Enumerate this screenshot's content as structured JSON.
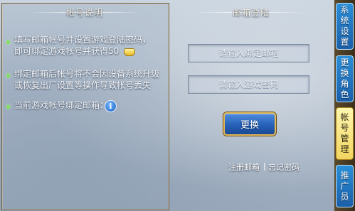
{
  "left_panel": {
    "title": "帐号说明",
    "item1_line1": "填写邮箱帐号并设置游戏登陆密码，",
    "item1_line2": "即可绑定游戏帐号并获得50",
    "item2_line1": "绑定邮箱后帐号将不会因设备系统升级",
    "item2_line2": "或恢复出厂设置等操作导致帐号丢失",
    "item3": "当前游戏帐号绑定邮箱：",
    "reward_icon": "gold-ingot-icon",
    "info_icon": "info-icon",
    "bullet_color": "#7fe05a"
  },
  "right_panel": {
    "title": "邮箱登陆",
    "email_placeholder": "请输入绑定邮箱",
    "password_placeholder": "请输入游戏密码",
    "email_value": "",
    "password_value": "",
    "submit_label": "更换",
    "register_link": "注册邮箱",
    "separator": "|",
    "forgot_link": "忘记密码"
  },
  "side_tabs": [
    {
      "label": [
        "系",
        "统",
        "设",
        "置"
      ],
      "active": false
    },
    {
      "label": [
        "更",
        "换",
        "角",
        "色"
      ],
      "active": false
    },
    {
      "label": [
        "帐",
        "号",
        "管",
        "理"
      ],
      "active": true
    },
    {
      "label": [
        "推",
        "广",
        "员"
      ],
      "active": false
    }
  ],
  "colors": {
    "tab_blue": "#2a8fd8",
    "tab_active": "#f2d560",
    "button_blue": "#2661b8",
    "button_border": "#e2b95a"
  }
}
